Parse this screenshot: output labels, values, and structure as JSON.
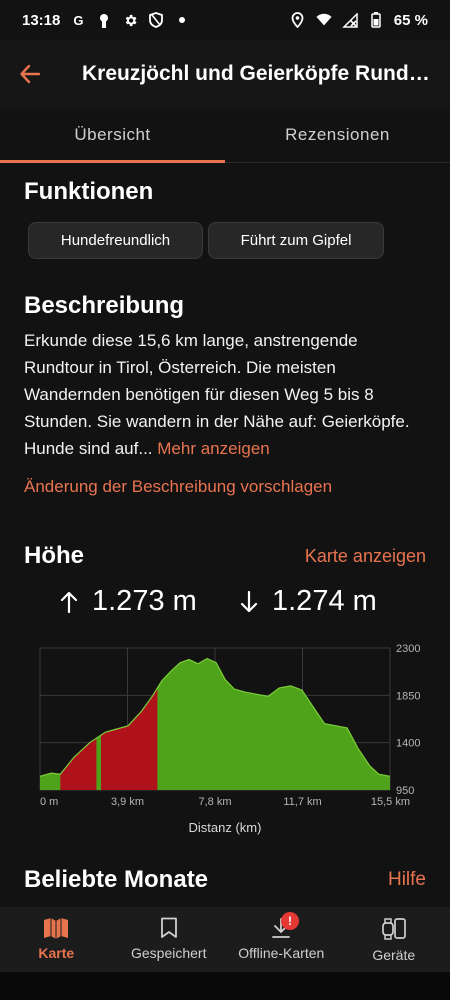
{
  "status_bar": {
    "time": "13:18",
    "battery": "65 %",
    "icons_left": [
      "google-icon",
      "keyhole-icon",
      "settings-icon",
      "shield-icon",
      "dot-icon"
    ],
    "icons_right": [
      "location-icon",
      "wifi-icon",
      "signal-icon",
      "battery-icon"
    ]
  },
  "app_bar": {
    "title": "Kreuzjöchl und Geierköpfe Rundtour"
  },
  "tabs": [
    {
      "label": "Übersicht",
      "active": true
    },
    {
      "label": "Rezensionen",
      "active": false
    }
  ],
  "features": {
    "heading": "Funktionen",
    "chips": [
      "Hundefreundlich",
      "Führt zum Gipfel"
    ]
  },
  "description": {
    "heading": "Beschreibung",
    "text": "Erkunde diese 15,6 km lange, anstrengende Rundtour in Tirol, Österreich. Die meisten Wandernden benötigen für diesen Weg 5 bis 8 Stunden. Sie wandern in der Nähe auf: Geierköpfe. Hunde sind auf...",
    "more_link": "Mehr anzeigen",
    "suggest_link": "Änderung der Beschreibung vorschlagen"
  },
  "elevation": {
    "heading": "Höhe",
    "map_link": "Karte anzeigen",
    "ascent": "1.273 m",
    "descent": "1.274 m"
  },
  "chart_data": {
    "type": "area",
    "xlabel": "Distanz (km)",
    "ylabel": "",
    "x_ticks": [
      "0 m",
      "3,9 km",
      "7,8 km",
      "11,7 km",
      "15,5 km"
    ],
    "y_ticks": [
      "950",
      "1400",
      "1850",
      "2300"
    ],
    "xlim": [
      0,
      15.5
    ],
    "ylim": [
      950,
      2300
    ],
    "grid": true,
    "colors": {
      "steep": "#b0121b",
      "normal": "#4ea31a"
    },
    "x": [
      0,
      0.5,
      0.9,
      1.5,
      2.2,
      2.9,
      3.4,
      3.9,
      4.5,
      5.0,
      5.4,
      5.8,
      6.2,
      6.6,
      7.0,
      7.4,
      7.8,
      8.2,
      8.6,
      9.1,
      9.6,
      10.1,
      10.6,
      11.1,
      11.6,
      12.1,
      12.6,
      13.1,
      13.6,
      14.1,
      14.6,
      15.0,
      15.5
    ],
    "y": [
      1080,
      1110,
      1100,
      1260,
      1400,
      1500,
      1530,
      1560,
      1700,
      1850,
      1990,
      2080,
      2160,
      2190,
      2150,
      2200,
      2160,
      2000,
      1910,
      1880,
      1860,
      1840,
      1920,
      1940,
      1900,
      1740,
      1580,
      1560,
      1540,
      1340,
      1180,
      1100,
      1080
    ],
    "steep_ranges": [
      [
        0.9,
        2.5
      ],
      [
        2.7,
        5.2
      ]
    ]
  },
  "popular_months": {
    "heading": "Beliebte Monate",
    "help_link": "Hilfe"
  },
  "bottom_nav": [
    {
      "label": "Karte",
      "icon": "map-icon",
      "active": true
    },
    {
      "label": "Gespeichert",
      "icon": "bookmark-icon",
      "active": false
    },
    {
      "label": "Offline-Karten",
      "icon": "download-icon",
      "active": false,
      "badge": "!"
    },
    {
      "label": "Geräte",
      "icon": "watch-phone-icon",
      "active": false
    }
  ]
}
